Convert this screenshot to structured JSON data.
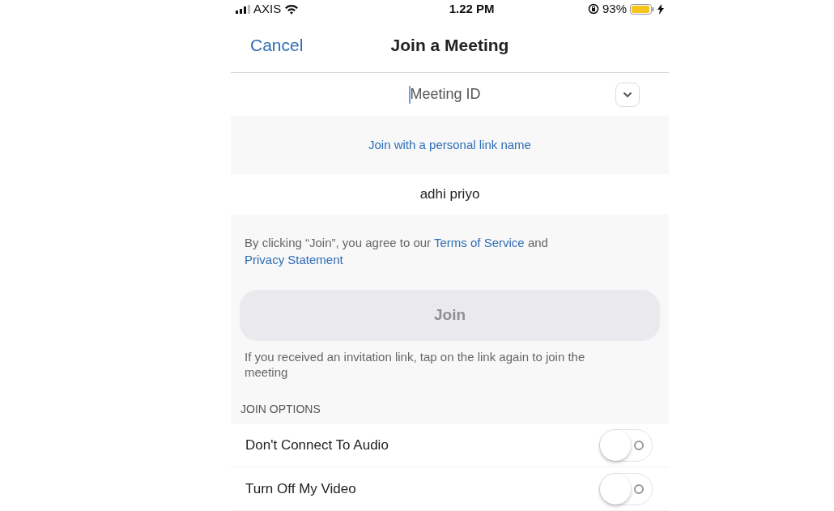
{
  "status_bar": {
    "carrier": "AXIS",
    "time": "1.22 PM",
    "battery": "93%"
  },
  "nav": {
    "cancel": "Cancel",
    "title": "Join a Meeting"
  },
  "meeting_id": {
    "placeholder": "Meeting ID"
  },
  "personal_link": "Join with a personal link name",
  "name_field": {
    "value": "adhi priyo"
  },
  "terms": {
    "prefix": "By clicking “Join”, you agree to our",
    "terms_link": "Terms of Service",
    "and": "and",
    "privacy_link": "Privacy Statement"
  },
  "join_button": {
    "label": "Join",
    "disabled": true
  },
  "hint": "If you received an invitation link, tap on the link again to join the meeting",
  "options_header": "JOIN OPTIONS",
  "options": [
    {
      "label": "Don't Connect To Audio",
      "on": false
    },
    {
      "label": "Turn Off My Video",
      "on": false
    }
  ]
}
